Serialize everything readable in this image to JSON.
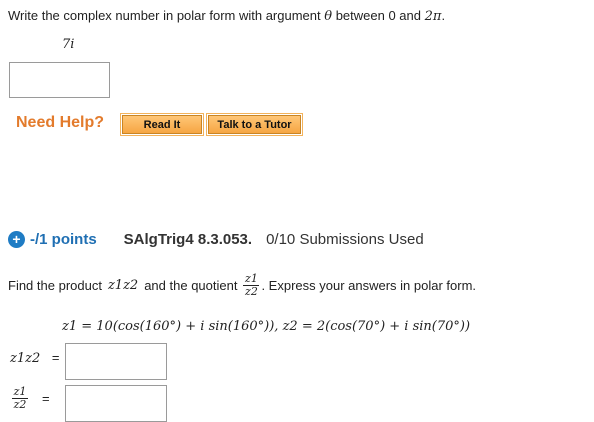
{
  "q1": {
    "prompt_start": "Write the complex number in polar form with argument",
    "theta": "θ",
    "prompt_mid": "between 0 and",
    "two_pi": "2π",
    "period": ".",
    "expression": "7i"
  },
  "help": {
    "label": "Need Help?",
    "read_it": "Read It",
    "talk_tutor": "Talk to a Tutor"
  },
  "q2": {
    "plus": "+",
    "points": "-/1 points",
    "course_id": "SAlgTrig4 8.3.053.",
    "submissions": "0/10 Submissions Used",
    "find_prefix": "Find the product",
    "product": "z1z2",
    "find_mid": "and the quotient",
    "frac_num": "z1",
    "frac_den": "z2",
    "find_suffix": ". Express your answers in polar form.",
    "given": "z1 = 10(cos(160°) + i sin(160°)),  z2 = 2(cos(70°) + i sin(70°))",
    "product_label": "z1z2",
    "equals": "=",
    "quot_num": "z1",
    "quot_den": "z2"
  }
}
